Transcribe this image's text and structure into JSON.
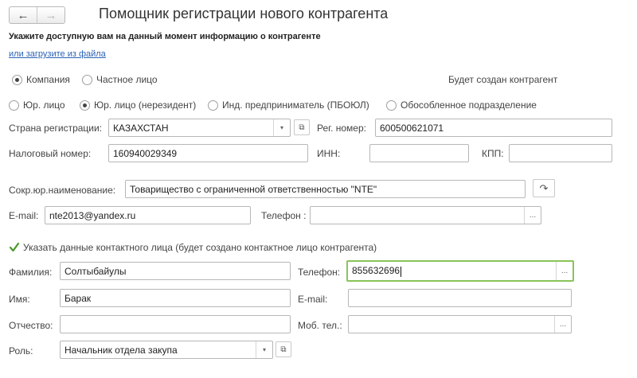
{
  "window": {
    "title": "Помощник регистрации нового контрагента",
    "back": "←",
    "forward": "→"
  },
  "intro": {
    "subtitle": "Укажите доступную вам на данный момент информацию о контрагенте",
    "load_link": "или загрузите из файла"
  },
  "kind": {
    "company": "Компания",
    "person": "Частное лицо",
    "selected": "company",
    "info": "Будет создан контрагент"
  },
  "legal_form": {
    "options": [
      "Юр. лицо",
      "Юр. лицо (нерезидент)",
      "Инд. предприниматель (ПБОЮЛ)",
      "Обособленное подразделение"
    ],
    "selected_index": 1
  },
  "form": {
    "country_label": "Страна регистрации:",
    "country_value": "КАЗАХСТАН",
    "regnum_label": "Рег. номер:",
    "regnum_value": "600500621071",
    "taxnum_label": "Налоговый номер:",
    "taxnum_value": "160940029349",
    "inn_label": "ИНН:",
    "inn_value": "",
    "kpp_label": "КПП:",
    "kpp_value": "",
    "shortname_label": "Сокр.юр.наименование:",
    "shortname_value": "Товарищество с ограниченной ответственностью \"NTE\"",
    "email_label": "E-mail:",
    "email_value": "nte2013@yandex.ru",
    "phone_label": "Телефон :",
    "phone_value": ""
  },
  "contact": {
    "checkbox_label": "Указать данные контактного лица (будет создано контактное лицо контрагента)",
    "checked": true,
    "surname_label": "Фамилия:",
    "surname_value": "Солтыбайулы",
    "phone_label": "Телефон:",
    "phone_value": "855632696",
    "name_label": "Имя:",
    "name_value": "Барак",
    "email_label": "E-mail:",
    "email_value": "",
    "patronymic_label": "Отчество:",
    "patronymic_value": "",
    "mobile_label": "Моб. тел.:",
    "mobile_value": "",
    "role_label": "Роль:",
    "role_value": "Начальник отдела закупа"
  },
  "icons": {
    "dropdown": "▾",
    "open": "⧉",
    "more": "...",
    "refresh": "↷"
  },
  "colors": {
    "focus_border": "#8ac45b",
    "link": "#2b62b5",
    "check": "#4a9a2a"
  }
}
